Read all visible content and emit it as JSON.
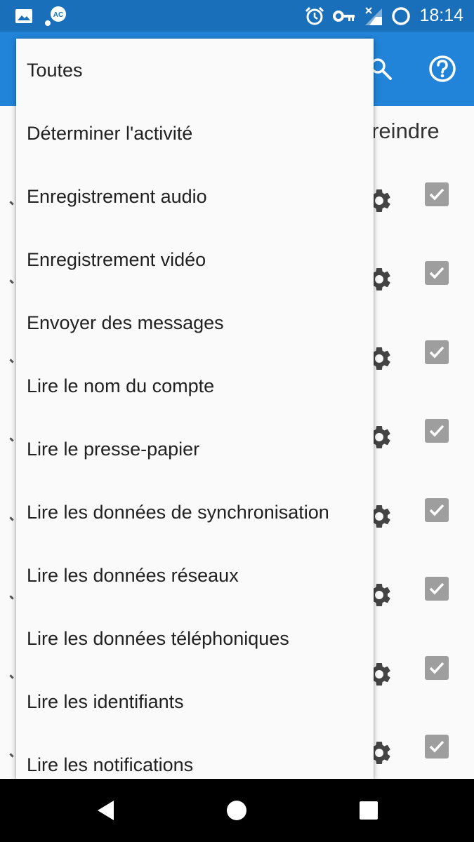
{
  "status_bar": {
    "time": "18:14",
    "icons": [
      "image-icon",
      "ac-app-icon",
      "alarm-icon",
      "vpn-key-icon",
      "no-signal-icon",
      "battery-ring-icon"
    ]
  },
  "app_bar": {
    "icons": [
      "search-icon",
      "help-icon"
    ]
  },
  "background": {
    "column_header": "streindre",
    "rows": [
      {
        "checked": true
      },
      {
        "checked": true
      },
      {
        "checked": true
      },
      {
        "checked": true
      },
      {
        "checked": true
      },
      {
        "checked": true
      },
      {
        "checked": true
      },
      {
        "checked": true
      }
    ]
  },
  "menu": {
    "items": [
      "Toutes",
      "Déterminer l'activité",
      "Enregistrement audio",
      "Enregistrement vidéo",
      "Envoyer des messages",
      "Lire le nom du compte",
      "Lire le presse-papier",
      "Lire les données de synchronisation",
      "Lire les données réseaux",
      "Lire les données téléphoniques",
      "Lire les identifiants",
      "Lire les notifications"
    ]
  },
  "nav_bar": {
    "buttons": [
      "back-icon",
      "home-icon",
      "recents-icon"
    ]
  },
  "colors": {
    "status_bar": "#1a6fba",
    "app_bar": "#2184d8",
    "menu_bg": "#fafafa",
    "checkbox": "#9e9e9e"
  }
}
